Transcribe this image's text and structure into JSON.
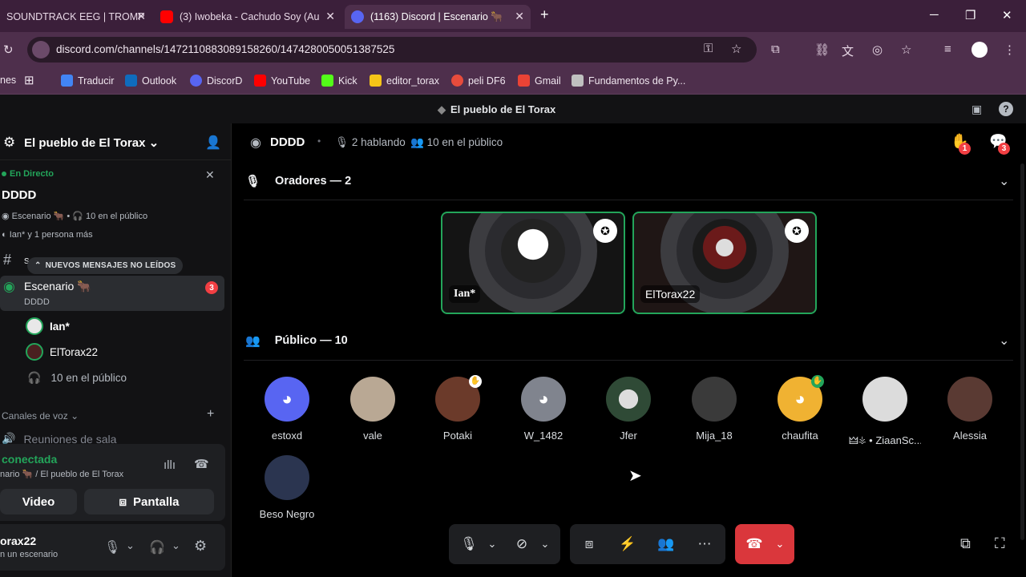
{
  "browser": {
    "tabs": [
      {
        "title": "SOUNDTRACK EEG | TROMP",
        "icon": "page-icon"
      },
      {
        "title": "(3) Iwobeka - Cachudo Soy (Au",
        "icon": "youtube-icon"
      },
      {
        "title": "(1163) Discord | Escenario 🐂",
        "icon": "discord-icon"
      }
    ],
    "url": "discord.com/channels/1472110883089158260/1474280050051387525",
    "bookmarks": [
      "nes",
      "Traducir",
      "Outlook",
      "DiscorD",
      "YouTube",
      "Kick",
      "editor_torax",
      "peli DF6",
      "Gmail",
      "Fundamentos de Py..."
    ]
  },
  "app": {
    "window_title": "El pueblo de El Torax"
  },
  "sidebar": {
    "server_name": "El pueblo de El Torax",
    "live_label": "En Directo",
    "stage_name": "DDDD",
    "stage_info": "Escenario 🐂 • 🎧 10 en el público",
    "speakers_line": "Ian* y 1 persona más",
    "channel_text_partial": "s",
    "new_messages_pill": "NUEVOS MENSAJES NO LEÍDOS",
    "stage_channel": "Escenario 🐂",
    "stage_channel_sub": "DDDD",
    "stage_badge": "3",
    "members": [
      "Ian*",
      "ElTorax22"
    ],
    "audience_line": "10 en el público",
    "voice_category": "Canales de voz",
    "voice_channel": "Reuniones de sala",
    "voice_status": "conectada",
    "voice_location": "nario 🐂 / El pueblo de El Torax",
    "video_label": "Video",
    "screen_label": "Pantalla",
    "user_name": "orax22",
    "user_status": "n un escenario"
  },
  "stage": {
    "title": "DDDD",
    "speaking": "2 hablando",
    "audience": "10 en el público",
    "hand_badge": "1",
    "inbox_badge": "3",
    "speakers_header": "Oradores — 2",
    "audience_header": "Público — 10",
    "speakers": [
      {
        "name": "Ian*",
        "bg": "#141414"
      },
      {
        "name": "ElTorax22",
        "bg": "#1f1615"
      }
    ],
    "audience_list": [
      {
        "name": "estoxd",
        "color": "#5865f2"
      },
      {
        "name": "vale",
        "color": "#b9a894"
      },
      {
        "name": "Potaki",
        "color": "#6b3a2a"
      },
      {
        "name": "W_1482",
        "color": "#80848e"
      },
      {
        "name": "Jfer",
        "color": "#2f4a36"
      },
      {
        "name": "Mija_18",
        "color": "#3a3a3a"
      },
      {
        "name": "chaufita",
        "color": "#f0b232"
      },
      {
        "name": "🜲⚶ • ZiaanSc...",
        "color": "#dcdcdc"
      },
      {
        "name": "Alessia",
        "color": "#5a3a33"
      },
      {
        "name": "Beso Negro",
        "color": "#2b3550"
      }
    ]
  },
  "colors": {
    "live_green": "#23a55a",
    "danger": "#da373c",
    "blurple": "#5865f2"
  }
}
